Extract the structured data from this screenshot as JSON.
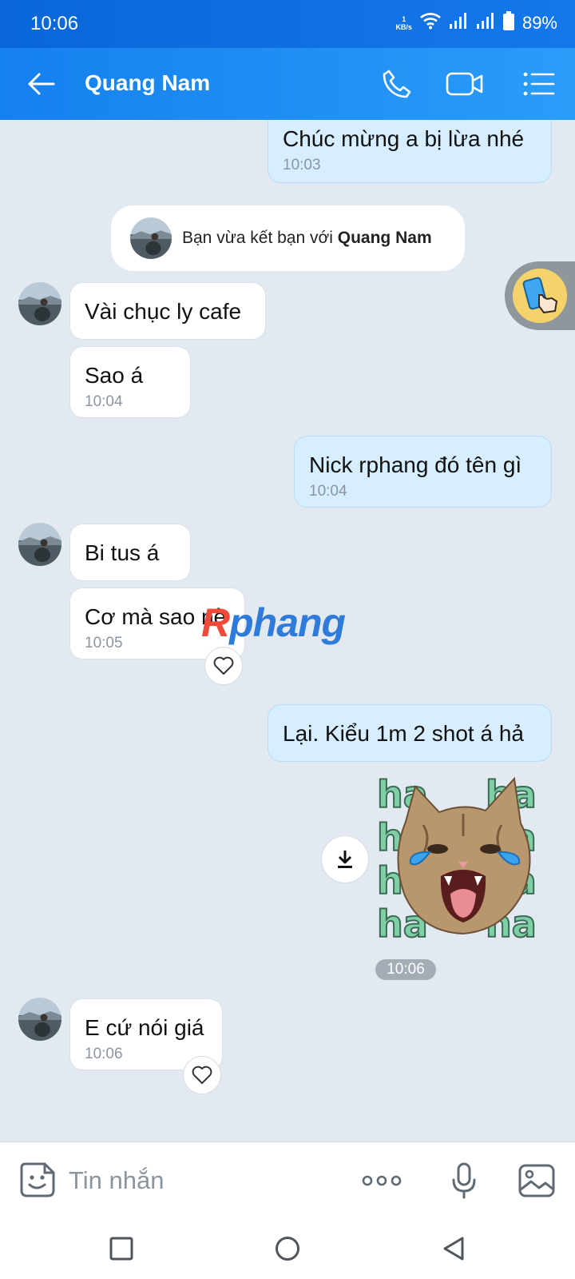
{
  "status_bar": {
    "time": "10:06",
    "net_speed_value": "1",
    "net_speed_unit": "KB/s",
    "battery_percent": "89%"
  },
  "header": {
    "contact_name": "Quang Nam",
    "icons": [
      "back-arrow-icon",
      "phone-icon",
      "video-call-icon",
      "menu-list-icon"
    ]
  },
  "chat": {
    "notice": {
      "prefix": "Bạn vừa kết bạn với ",
      "name": "Quang Nam"
    },
    "messages": [
      {
        "side": "out",
        "text": "Chúc mừng a bị lừa nhé",
        "time": "10:03"
      },
      {
        "side": "in",
        "text": "Vài chục ly cafe",
        "time": ""
      },
      {
        "side": "in",
        "text": "Sao á",
        "time": "10:04"
      },
      {
        "side": "out",
        "text": "Nick rphang đó tên gì",
        "time": "10:04"
      },
      {
        "side": "in",
        "text": "Bi tus á",
        "time": ""
      },
      {
        "side": "in",
        "text": "Cơ mà sao nè",
        "time": "10:05"
      },
      {
        "side": "out",
        "text": "Lại. Kiểu 1m 2 shot á hả",
        "time": ""
      },
      {
        "side": "in",
        "text": "E cứ nói giá",
        "time": "10:06"
      }
    ],
    "sticker": {
      "word": "ha",
      "time": "10:06"
    },
    "watermark": {
      "first": "R",
      "rest": "phang"
    }
  },
  "input_bar": {
    "placeholder": "Tin nhắn"
  },
  "colors": {
    "header_blue": "#1a86f0",
    "chat_background": "#e2e9f1",
    "outgoing_bubble": "#d6eeff",
    "incoming_bubble": "#ffffff"
  }
}
